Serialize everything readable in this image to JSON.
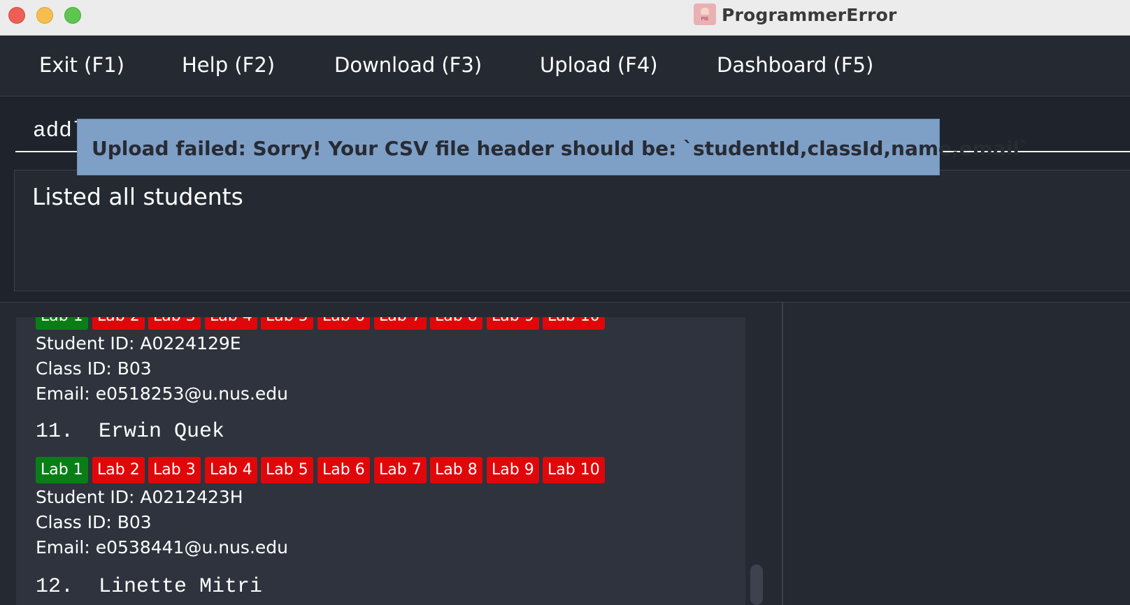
{
  "window": {
    "title": "ProgrammerError",
    "app_icon_text": "PIE"
  },
  "menu": {
    "items": [
      {
        "label": "Exit (F1)"
      },
      {
        "label": "Help (F2)"
      },
      {
        "label": "Download (F3)"
      },
      {
        "label": "Upload (F4)"
      },
      {
        "label": "Dashboard (F5)"
      }
    ]
  },
  "command_box": {
    "value": "addlab -ln"
  },
  "result_display": {
    "text": "Listed all students"
  },
  "toast": {
    "message": "Upload failed: Sorry! Your CSV file header should be: `studentId,classId,name,email`"
  },
  "colors": {
    "lab_done": "#0a7e16",
    "lab_todo": "#e0070a",
    "toast_bg": "#7e9fc6",
    "background": "#1f232b"
  },
  "students": [
    {
      "index_name": "",
      "labs": [
        "Lab 1",
        "Lab 2",
        "Lab 3",
        "Lab 4",
        "Lab 5",
        "Lab 6",
        "Lab 7",
        "Lab 8",
        "Lab 9",
        "Lab 10"
      ],
      "labs_done": [
        true,
        false,
        false,
        false,
        false,
        false,
        false,
        false,
        false,
        false
      ],
      "student_id": "Student ID: A0224129E",
      "class_id": "Class ID: B03",
      "email": "Email: e0518253@u.nus.edu"
    },
    {
      "index_name": "11.  Erwin Quek",
      "labs": [
        "Lab 1",
        "Lab 2",
        "Lab 3",
        "Lab 4",
        "Lab 5",
        "Lab 6",
        "Lab 7",
        "Lab 8",
        "Lab 9",
        "Lab 10"
      ],
      "labs_done": [
        true,
        false,
        false,
        false,
        false,
        false,
        false,
        false,
        false,
        false
      ],
      "student_id": "Student ID: A0212423H",
      "class_id": "Class ID: B03",
      "email": "Email: e0538441@u.nus.edu"
    },
    {
      "index_name": "12.  Linette Mitri"
    }
  ]
}
